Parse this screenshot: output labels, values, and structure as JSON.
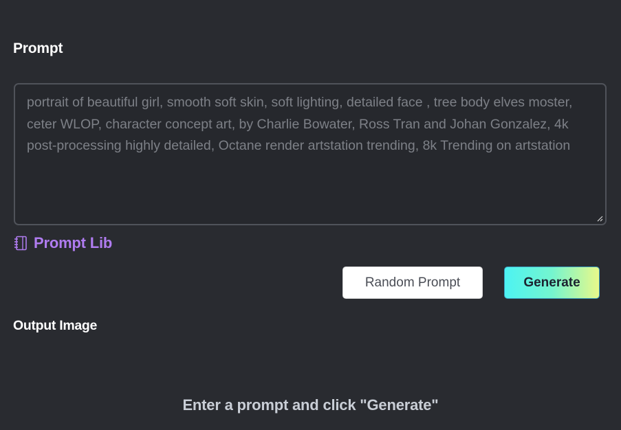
{
  "prompt_section": {
    "heading": "Prompt",
    "prompt_text": "portrait of beautiful girl, smooth soft skin, soft lighting, detailed face , tree body elves moster, ceter WLOP, character concept art, by Charlie Bowater, Ross Tran and Johan Gonzalez, 4k post-processing highly detailed, Octane render artstation trending, 8k Trending on artstation"
  },
  "prompt_lib": {
    "label": "Prompt Lib",
    "icon": "notebook-icon",
    "color": "#b07cf0"
  },
  "actions": {
    "random_label": "Random Prompt",
    "generate_label": "Generate"
  },
  "output_section": {
    "heading": "Output Image",
    "empty_message": "Enter a prompt and click \"Generate\""
  },
  "colors": {
    "background": "#292b30",
    "accent_gradient_start": "#4df3f2",
    "accent_gradient_end": "#e8f889"
  }
}
